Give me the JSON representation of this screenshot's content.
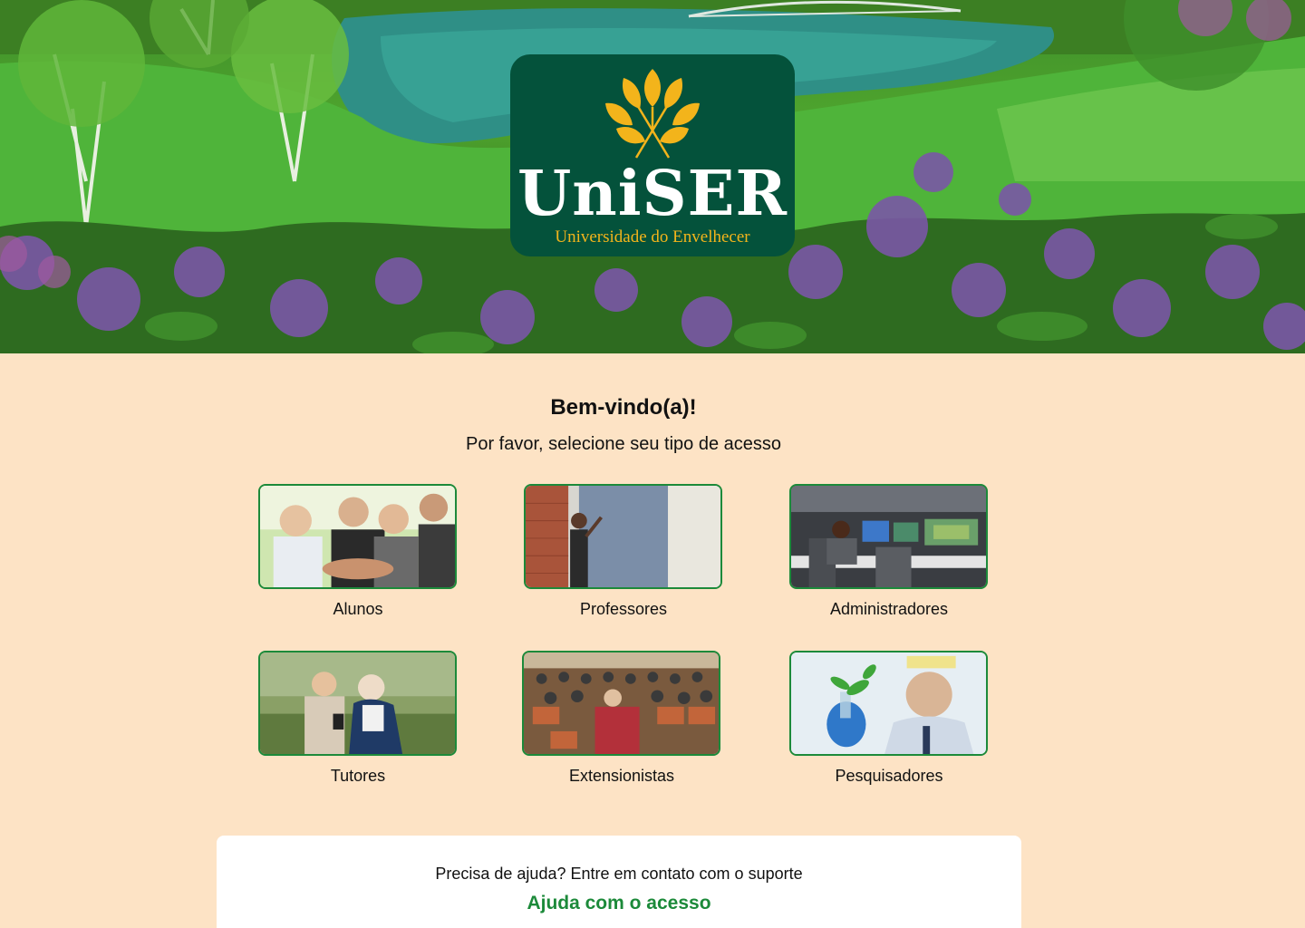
{
  "brand": {
    "name": "UniSER",
    "tagline": "Universidade do Envelhecer",
    "logo_bg": "#04523b",
    "logo_accent": "#f3b41b"
  },
  "welcome": {
    "title": "Bem-vindo(a)!",
    "subtitle": "Por favor, selecione seu tipo de acesso"
  },
  "access_types": [
    {
      "label": "Alunos",
      "image": "seniors-group-photo"
    },
    {
      "label": "Professores",
      "image": "teacher-at-board-photo"
    },
    {
      "label": "Administradores",
      "image": "control-room-photo"
    },
    {
      "label": "Tutores",
      "image": "tutor-with-senior-photo"
    },
    {
      "label": "Extensionistas",
      "image": "lecture-audience-photo"
    },
    {
      "label": "Pesquisadores",
      "image": "researcher-with-plant-photo"
    }
  ],
  "help": {
    "text": "Precisa de ajuda? Entre em contato com o suporte",
    "link": "Ajuda com o acesso"
  },
  "colors": {
    "page_bg": "#fde3c5",
    "accent_green": "#1c8a3a",
    "card_border": "#1c8a3a"
  }
}
